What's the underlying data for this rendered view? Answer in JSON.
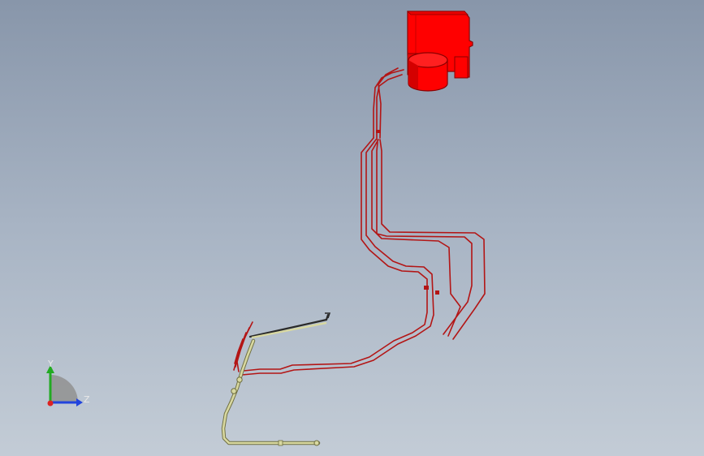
{
  "viewport": {
    "background_top": "#8896aa",
    "background_bottom": "#c3ccd6"
  },
  "model": {
    "motor_color": "#ff0000",
    "motor_dark": "#c80000",
    "harness_color": "#b31515",
    "harness_highlight": "#e06060",
    "bracket_color": "#d8d8a0",
    "bracket_outline": "#6e6e40",
    "rod_color": "#2a2a2a"
  },
  "triad": {
    "y_label": "Y",
    "z_label": "Z",
    "y_color": "#22aa22",
    "z_color": "#2244dd",
    "x_color": "#dd2222"
  }
}
